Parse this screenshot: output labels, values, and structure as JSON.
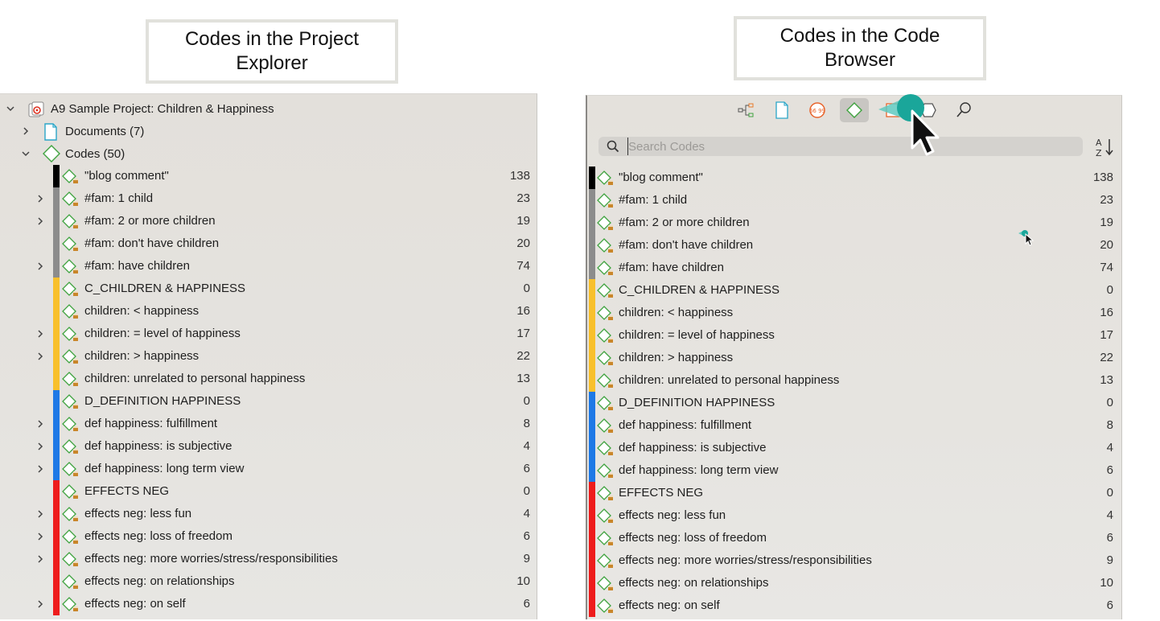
{
  "captions": {
    "left": "Codes in the Project\nExplorer",
    "right": "Codes in the Code\nBrowser"
  },
  "explorer": {
    "project_label": "A9 Sample Project: Children & Happiness",
    "documents_label": "Documents (7)",
    "codes_label": "Codes (50)"
  },
  "browser": {
    "toolbar": [
      "network-icon",
      "document-icon",
      "quotation-icon",
      "code-icon",
      "memo-icon",
      "entity-icon",
      "search-icon"
    ],
    "active_tool": "code-icon",
    "search_placeholder": "Search Codes",
    "sort_label": "A-Z sort"
  },
  "colors": {
    "black": "#000000",
    "gray": "#8c8c8c",
    "orange": "#f8c02c",
    "blue": "#1e79e6",
    "red": "#ee1c1c",
    "code_icon_green": "#3fa33f",
    "cursor_teal": "#1aa69a"
  },
  "codes": [
    {
      "label": "\"blog comment\"",
      "count": "138",
      "color": "black",
      "expandable": false
    },
    {
      "label": "#fam: 1 child",
      "count": "23",
      "color": "gray",
      "expandable": true
    },
    {
      "label": "#fam: 2 or more  children",
      "count": "19",
      "color": "gray",
      "expandable": true
    },
    {
      "label": "#fam: don't have children",
      "count": "20",
      "color": "gray",
      "expandable": false
    },
    {
      "label": "#fam: have children",
      "count": "74",
      "color": "gray",
      "expandable": true
    },
    {
      "label": "C_CHILDREN & HAPPINESS",
      "count": "0",
      "color": "orange",
      "expandable": false
    },
    {
      "label": "children: < happiness",
      "count": "16",
      "color": "orange",
      "expandable": false
    },
    {
      "label": "children: = level of happiness",
      "count": "17",
      "color": "orange",
      "expandable": true
    },
    {
      "label": "children: > happiness",
      "count": "22",
      "color": "orange",
      "expandable": true
    },
    {
      "label": "children: unrelated to personal happiness",
      "count": "13",
      "color": "orange",
      "expandable": false
    },
    {
      "label": "D_DEFINITION HAPPINESS",
      "count": "0",
      "color": "blue",
      "expandable": false
    },
    {
      "label": "def happiness: fulfillment",
      "count": "8",
      "color": "blue",
      "expandable": true
    },
    {
      "label": "def happiness: is subjective",
      "count": "4",
      "color": "blue",
      "expandable": true
    },
    {
      "label": "def happiness: long term view",
      "count": "6",
      "color": "blue",
      "expandable": true
    },
    {
      "label": "EFFECTS NEG",
      "count": "0",
      "color": "red",
      "expandable": false
    },
    {
      "label": "effects neg: less fun",
      "count": "4",
      "color": "red",
      "expandable": true
    },
    {
      "label": "effects neg: loss of freedom",
      "count": "6",
      "color": "red",
      "expandable": true
    },
    {
      "label": "effects neg: more worries/stress/responsibilities",
      "count": "9",
      "color": "red",
      "expandable": true
    },
    {
      "label": "effects neg: on relationships",
      "count": "10",
      "color": "red",
      "expandable": false
    },
    {
      "label": "effects neg: on self",
      "count": "6",
      "color": "red",
      "expandable": true
    }
  ]
}
